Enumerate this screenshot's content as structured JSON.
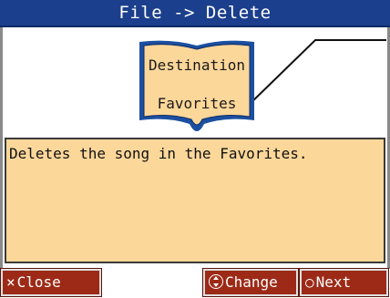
{
  "window": {
    "title": "File -> Delete"
  },
  "destination": {
    "label": "Destination",
    "value": "Favorites"
  },
  "description": {
    "text": "Deletes the song in the Favorites."
  },
  "buttons": {
    "close": {
      "label": "Close",
      "icon": "cross-icon",
      "glyph": "×"
    },
    "change": {
      "label": "Change",
      "icon": "dial-up-down-icon"
    },
    "next": {
      "label": "Next",
      "icon": "circle-icon",
      "glyph": "○"
    }
  },
  "colors": {
    "title_bar": "#1b3f8c",
    "panel": "#fcd79a",
    "button": "#9c2a17",
    "book_fill": "#fcd79a",
    "book_border": "#1b4fa0"
  }
}
